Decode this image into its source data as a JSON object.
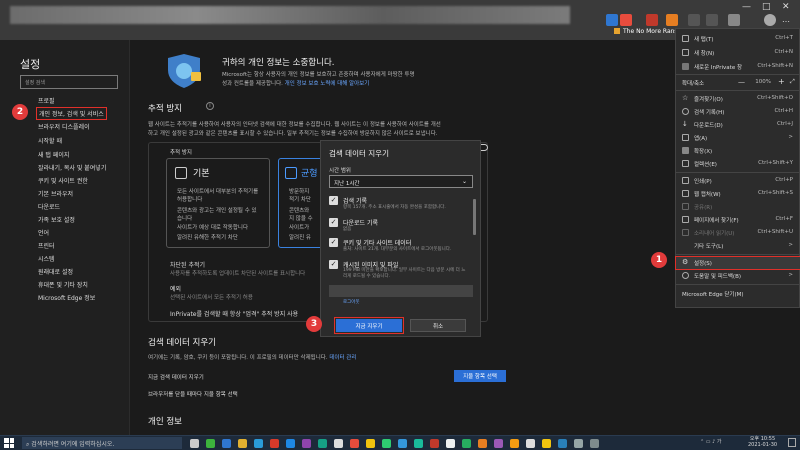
{
  "browser": {
    "tab_label": "The No More Rans...",
    "window_controls": [
      "—",
      "□",
      "✕"
    ]
  },
  "sidebar": {
    "title": "설정",
    "search_placeholder": "설정 검색",
    "items": [
      {
        "label": "프로필"
      },
      {
        "label": "개인 정보, 검색 및 서비스",
        "active": true
      },
      {
        "label": "브라우저 디스플레이"
      },
      {
        "label": "시작할 때"
      },
      {
        "label": "새 탭 페이지"
      },
      {
        "label": "잘라내기, 복사 및 붙여넣기"
      },
      {
        "label": "쿠키 및 사이트 권한"
      },
      {
        "label": "기본 브라우저"
      },
      {
        "label": "다운로드"
      },
      {
        "label": "가족 보호 설정"
      },
      {
        "label": "언어"
      },
      {
        "label": "프린터"
      },
      {
        "label": "시스템"
      },
      {
        "label": "원래대로 설정"
      },
      {
        "label": "휴대폰 및 기타 장치"
      },
      {
        "label": "Microsoft Edge 정보"
      }
    ]
  },
  "main": {
    "privacy_title": "귀하의 개인 정보는 소중합니다.",
    "privacy_desc_1": "Microsoft는 항상 사용자의 개인 정보를 보호하고 존중하며 사용자에게 마땅한 투명",
    "privacy_desc_2": "성과 컨트롤을 제공합니다.",
    "privacy_link": "개인 정보 보호 노력에 대해 알아보기",
    "tracking_title": "추적 방지",
    "tracking_desc_1": "웹 사이트는 추적기를 사용하여 사용자의 인터넷 검색에 대한 정보를 수집합니다. 웹 사이트는 이 정보를 사용하여 사이트를 개선",
    "tracking_desc_2": "하고 개인 설정된 광고와 같은 콘텐츠를 표시할 수 있습니다. 일부 추적기는 정보를 수집하여 방문하지 않은 사이트로 보냅니다.",
    "tracking_box_label": "추적 방지",
    "card_basic": {
      "title": "기본",
      "lines": [
        "모든 사이트에서 대부분의 추적기를",
        "허용합니다",
        "콘텐츠와 광고는 개인 설정될 수 있",
        "습니다",
        "사이트가 예상 대로 작동합니다",
        "알려진 유해한 추적기 차단"
      ]
    },
    "card_balanced": {
      "title": "균형",
      "lines": [
        "방문하지",
        "적기 차단",
        "콘텐츠와",
        "지 않을 수",
        "사이트가",
        "알려진 유"
      ]
    },
    "blocked_trackers_title": "차단된 추적기",
    "blocked_trackers_desc": "사용자를 추적하도록 업데이트 차단된 사이트를 표시합니다",
    "exceptions_title": "예외",
    "exceptions_desc": "선택된 사이트에서 모든 추적기 허용",
    "inprivate_text": "InPrivate를 검색할 때 항상 \"엄격\" 추적 방지 사용",
    "clear_title": "검색 데이터 지우기",
    "clear_desc": "여기에는 기록, 암호, 쿠키 등이 포함됩니다. 이 프로필의 데이터만 삭제됩니다.",
    "clear_link": "데이터 관리",
    "clear_now_label": "지금 검색 데이터 지우기",
    "choose_button": "지울 항목 선택",
    "clear_on_close": "브라우저를 닫을 때마다 지울 항목 선택",
    "personal_info_title": "개인 정보"
  },
  "dialog": {
    "title": "검색 데이터 지우기",
    "time_range_label": "시간 범위",
    "time_range_value": "지난 1시간",
    "options": [
      {
        "title": "검색 기록",
        "desc": "항목 157개. 주소 표시줄에서 자동 완성을 포함합니다.",
        "checked": true
      },
      {
        "title": "다운로드 기록",
        "desc": "없음",
        "checked": true
      },
      {
        "title": "쿠키 및 기타 사이트 데이터",
        "desc": "출처: 사이트 21개. 대부분의 사이트에서 로그아웃됩니다.",
        "checked": true
      },
      {
        "title": "캐시된 이미지 및 파일",
        "desc": "199 MB 미만을 확보합니다. 일부 사이트는 다음 방문 시에 더 느리게 로드될 수 있습니다.",
        "checked": true
      }
    ],
    "signout_link": "로그아웃",
    "confirm": "지금 지우기",
    "cancel": "취소"
  },
  "menu": {
    "items": [
      {
        "label": "새 탭(T)",
        "shortcut": "Ctrl+T",
        "icon": "new-tab-icon"
      },
      {
        "label": "새 창(N)",
        "shortcut": "Ctrl+N",
        "icon": "new-window-icon"
      },
      {
        "label": "새로운 InPrivate 창",
        "shortcut": "Ctrl+Shift+N",
        "icon": "inprivate-icon"
      },
      {
        "label": "확대/축소",
        "shortcut": "100%",
        "icon": "zoom-icon"
      },
      {
        "label": "즐겨찾기(O)",
        "shortcut": "Ctrl+Shift+O",
        "icon": "favorites-icon"
      },
      {
        "label": "검색 기록(H)",
        "shortcut": "Ctrl+H",
        "icon": "history-icon"
      },
      {
        "label": "다운로드(D)",
        "shortcut": "Ctrl+J",
        "icon": "downloads-icon"
      },
      {
        "label": "앱(A)",
        "shortcut": ">",
        "icon": "apps-icon"
      },
      {
        "label": "확장(X)",
        "shortcut": "",
        "icon": "extensions-icon"
      },
      {
        "label": "컬렉션(E)",
        "shortcut": "Ctrl+Shift+Y",
        "icon": "collections-icon"
      },
      {
        "label": "인쇄(P)",
        "shortcut": "Ctrl+P",
        "icon": "print-icon"
      },
      {
        "label": "웹 캡처(W)",
        "shortcut": "Ctrl+Shift+S",
        "icon": "capture-icon"
      },
      {
        "label": "공유(R)",
        "shortcut": "",
        "icon": "share-icon"
      },
      {
        "label": "페이지에서 찾기(F)",
        "shortcut": "Ctrl+F",
        "icon": "find-icon"
      },
      {
        "label": "소리내어 읽기(U)",
        "shortcut": "Ctrl+Shift+U",
        "icon": "read-aloud-icon"
      },
      {
        "label": "기타 도구(L)",
        "shortcut": ">",
        "icon": "tools-icon"
      },
      {
        "label": "설정(S)",
        "shortcut": "",
        "icon": "gear-icon"
      },
      {
        "label": "도움말 및 피드백(B)",
        "shortcut": ">",
        "icon": "help-icon"
      },
      {
        "label": "Microsoft Edge 닫기(M)",
        "shortcut": "",
        "icon": "close-icon"
      }
    ]
  },
  "badges": [
    "1",
    "2",
    "3"
  ],
  "taskbar": {
    "search_placeholder": "검색하려면 여기에 입력하십시오.",
    "time": "오후 10:55",
    "date": "2021-01-30"
  }
}
